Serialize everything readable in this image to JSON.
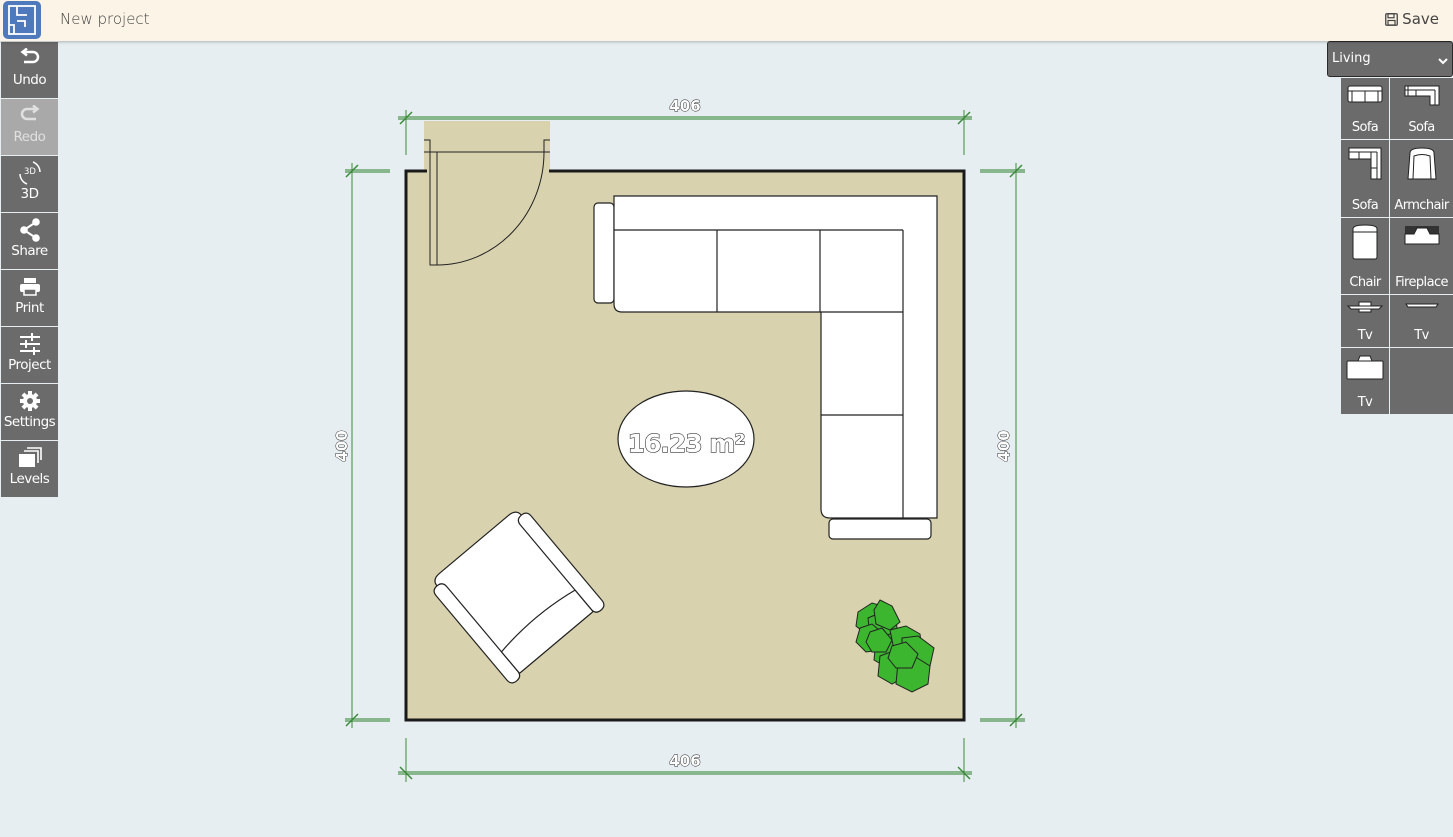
{
  "app": {
    "title": "New project",
    "save_label": "Save"
  },
  "toolbar": {
    "items": [
      {
        "id": "undo",
        "label": "Undo",
        "icon": "undo-icon",
        "enabled": true
      },
      {
        "id": "redo",
        "label": "Redo",
        "icon": "redo-icon",
        "enabled": false
      },
      {
        "id": "3d",
        "label": "3D",
        "icon": "3d-rotate-icon",
        "icon_text": "3D",
        "enabled": true
      },
      {
        "id": "share",
        "label": "Share",
        "icon": "share-icon",
        "enabled": true
      },
      {
        "id": "print",
        "label": "Print",
        "icon": "print-icon",
        "enabled": true
      },
      {
        "id": "project",
        "label": "Project",
        "icon": "sliders-icon",
        "enabled": true
      },
      {
        "id": "settings",
        "label": "Settings",
        "icon": "gear-icon",
        "enabled": true
      },
      {
        "id": "levels",
        "label": "Levels",
        "icon": "layers-icon",
        "enabled": true
      }
    ]
  },
  "catalog": {
    "selected_category": "Living",
    "items": [
      {
        "label": "Sofa",
        "icon": "sofa-two-seat-icon"
      },
      {
        "label": "Sofa",
        "icon": "sofa-corner-icon"
      },
      {
        "label": "Sofa",
        "icon": "sofa-l-shape-icon"
      },
      {
        "label": "Armchair",
        "icon": "armchair-icon"
      },
      {
        "label": "Chair",
        "icon": "chair-icon"
      },
      {
        "label": "Fireplace",
        "icon": "fireplace-icon"
      },
      {
        "label": "Tv",
        "icon": "tv-stand-icon"
      },
      {
        "label": "Tv",
        "icon": "tv-flat-icon"
      },
      {
        "label": "Tv",
        "icon": "tv-crt-icon"
      }
    ]
  },
  "plan": {
    "room": {
      "area_label": "16.23 m²",
      "floor_color": "#d8d2ae",
      "wall_color": "#1a1a1a"
    },
    "dimensions": {
      "top": "406",
      "bottom": "406",
      "left": "400",
      "right": "400"
    },
    "dimension_color": "#3b8a3b",
    "plant_color": "#3cb52f"
  }
}
